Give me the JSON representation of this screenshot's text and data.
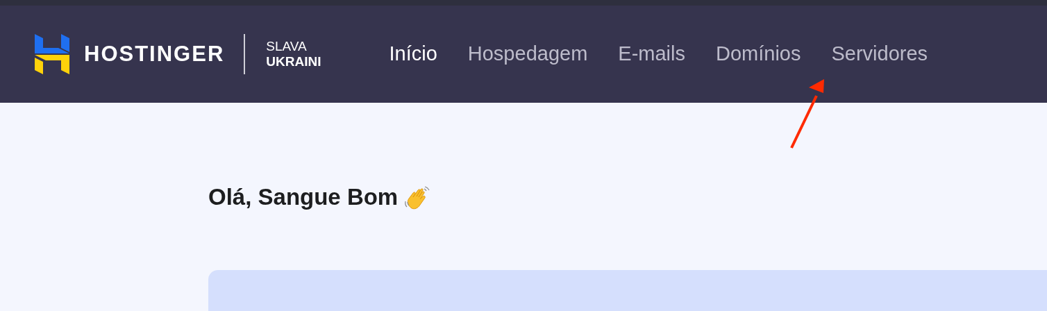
{
  "header": {
    "logo": {
      "brand": "HOSTINGER",
      "tagline_top": "SLAVA",
      "tagline_bottom": "UKRAINI"
    },
    "nav": [
      {
        "label": "Início",
        "selected": true
      },
      {
        "label": "Hospedagem",
        "selected": false
      },
      {
        "label": "E-mails",
        "selected": false
      },
      {
        "label": "Domínios",
        "selected": false
      },
      {
        "label": "Servidores",
        "selected": false
      }
    ]
  },
  "greeting": "Olá, Sangue Bom",
  "annotation": {
    "kind": "arrow"
  }
}
